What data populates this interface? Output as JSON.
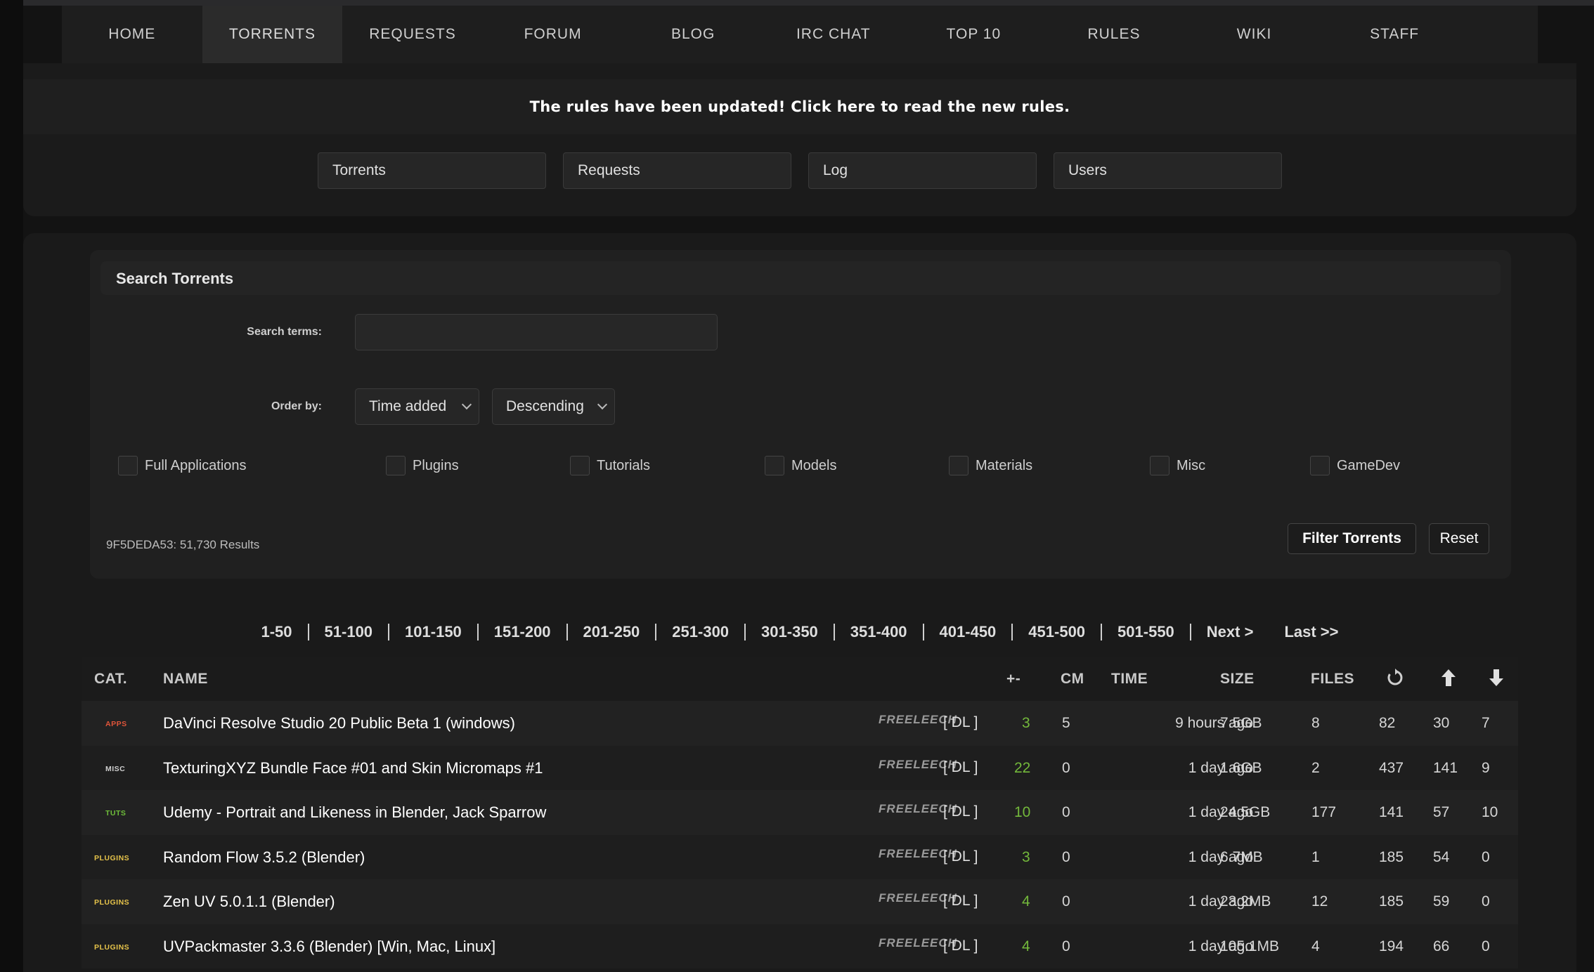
{
  "nav": {
    "items": [
      {
        "label": "HOME"
      },
      {
        "label": "TORRENTS"
      },
      {
        "label": "REQUESTS"
      },
      {
        "label": "FORUM"
      },
      {
        "label": "BLOG"
      },
      {
        "label": "IRC CHAT"
      },
      {
        "label": "TOP 10"
      },
      {
        "label": "RULES"
      },
      {
        "label": "WIKI"
      },
      {
        "label": "STAFF"
      }
    ],
    "active": "TORRENTS"
  },
  "announcement": "The rules have been updated! Click here to read the new rules.",
  "quick_search": {
    "torrents_placeholder": "Torrents",
    "requests_placeholder": "Requests",
    "log_placeholder": "Log",
    "users_placeholder": "Users"
  },
  "search": {
    "title": "Search Torrents",
    "terms_label": "Search terms:",
    "terms_value": "",
    "order_label": "Order by:",
    "order_by": "Time added",
    "order_dir": "Descending",
    "categories": [
      {
        "label": "Full Applications",
        "checked": false
      },
      {
        "label": "Plugins",
        "checked": false
      },
      {
        "label": "Tutorials",
        "checked": false
      },
      {
        "label": "Models",
        "checked": false
      },
      {
        "label": "Materials",
        "checked": false
      },
      {
        "label": "Misc",
        "checked": false
      },
      {
        "label": "GameDev",
        "checked": false
      }
    ],
    "results": "9F5DEDA53: 51,730 Results",
    "filter_label": "Filter Torrents",
    "reset_label": "Reset"
  },
  "pagination": {
    "pages": [
      "1-50",
      "51-100",
      "101-150",
      "151-200",
      "201-250",
      "251-300",
      "301-350",
      "351-400",
      "401-450",
      "451-500",
      "501-550"
    ],
    "next": "Next >",
    "last": "Last >>"
  },
  "table": {
    "headers": {
      "cat": "CAT.",
      "name": "NAME",
      "pm": "+-",
      "cm": "CM",
      "time": "TIME",
      "size": "SIZE",
      "files": "FILES"
    },
    "icons": {
      "snatched": "refresh-icon",
      "seeders": "arrow-up-icon",
      "leechers": "arrow-down-icon"
    },
    "rows": [
      {
        "cat": "APPS",
        "cat_color": "#e0553a",
        "name": "DaVinci Resolve Studio 20 Public Beta 1 (windows)",
        "tag": "FREELEECH",
        "dl": "[ DL ]",
        "pm": "3",
        "cm": "5",
        "time": "9 hours ago",
        "size": "7.5GB",
        "files": "8",
        "snatched": "82",
        "seeders": "30",
        "leechers": "7"
      },
      {
        "cat": "MISC",
        "cat_color": "#cfcfcf",
        "name": "TexturingXYZ Bundle Face #01 and Skin Micromaps #1",
        "tag": "FREELEECH",
        "dl": "[ DL ]",
        "pm": "22",
        "cm": "0",
        "time": "1 day ago",
        "size": "1.6GB",
        "files": "2",
        "snatched": "437",
        "seeders": "141",
        "leechers": "9"
      },
      {
        "cat": "TUTS",
        "cat_color": "#6fbf3a",
        "name": "Udemy - Portrait and Likeness in Blender, Jack Sparrow",
        "tag": "FREELEECH",
        "dl": "[ DL ]",
        "pm": "10",
        "cm": "0",
        "time": "1 day ago",
        "size": "24.5GB",
        "files": "177",
        "snatched": "141",
        "seeders": "57",
        "leechers": "10"
      },
      {
        "cat": "PLUGINS",
        "cat_color": "#e6c34a",
        "name": "Random Flow 3.5.2 (Blender)",
        "tag": "FREELEECH",
        "dl": "[ DL ]",
        "pm": "3",
        "cm": "0",
        "time": "1 day ago",
        "size": "6.7MB",
        "files": "1",
        "snatched": "185",
        "seeders": "54",
        "leechers": "0"
      },
      {
        "cat": "PLUGINS",
        "cat_color": "#e6c34a",
        "name": "Zen UV 5.0.1.1 (Blender)",
        "tag": "FREELEECH",
        "dl": "[ DL ]",
        "pm": "4",
        "cm": "0",
        "time": "1 day ago",
        "size": "23.2MB",
        "files": "12",
        "snatched": "185",
        "seeders": "59",
        "leechers": "0"
      },
      {
        "cat": "PLUGINS",
        "cat_color": "#e6c34a",
        "name": "UVPackmaster 3.3.6 (Blender) [Win, Mac, Linux]",
        "tag": "FREELEECH",
        "dl": "[ DL ]",
        "pm": "4",
        "cm": "0",
        "time": "1 day ago",
        "size": "105.1MB",
        "files": "4",
        "snatched": "194",
        "seeders": "66",
        "leechers": "0"
      }
    ]
  }
}
